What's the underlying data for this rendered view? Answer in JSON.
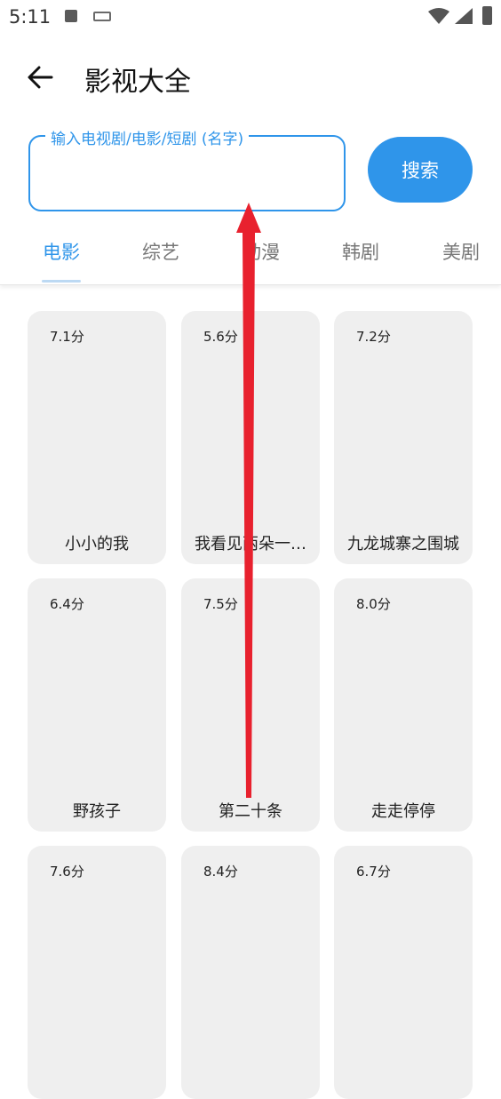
{
  "status_bar": {
    "time": "5:11",
    "icons": [
      "font-icon",
      "keyboard-icon",
      "wifi-icon",
      "signal-icon",
      "battery-icon"
    ]
  },
  "header": {
    "title": "影视大全",
    "back_icon": "back-arrow-icon"
  },
  "search": {
    "label": "输入电视剧/电影/短剧 (名字)",
    "value": "",
    "button_label": "搜索"
  },
  "tabs": [
    {
      "label": "电影",
      "active": true
    },
    {
      "label": "综艺",
      "active": false
    },
    {
      "label": "动漫",
      "active": false
    },
    {
      "label": "韩剧",
      "active": false
    },
    {
      "label": "美剧",
      "active": false
    }
  ],
  "cards": [
    {
      "score": "7.1分",
      "title": "小小的我"
    },
    {
      "score": "5.6分",
      "title": "我看见两朵一…"
    },
    {
      "score": "7.2分",
      "title": "九龙城寨之围城"
    },
    {
      "score": "6.4分",
      "title": "野孩子"
    },
    {
      "score": "7.5分",
      "title": "第二十条"
    },
    {
      "score": "8.0分",
      "title": "走走停停"
    },
    {
      "score": "7.6分",
      "title": ""
    },
    {
      "score": "8.4分",
      "title": ""
    },
    {
      "score": "6.7分",
      "title": ""
    }
  ],
  "colors": {
    "accent": "#2f95ea",
    "card_bg": "#efefef",
    "overlay_arrow": "#e8212e"
  }
}
